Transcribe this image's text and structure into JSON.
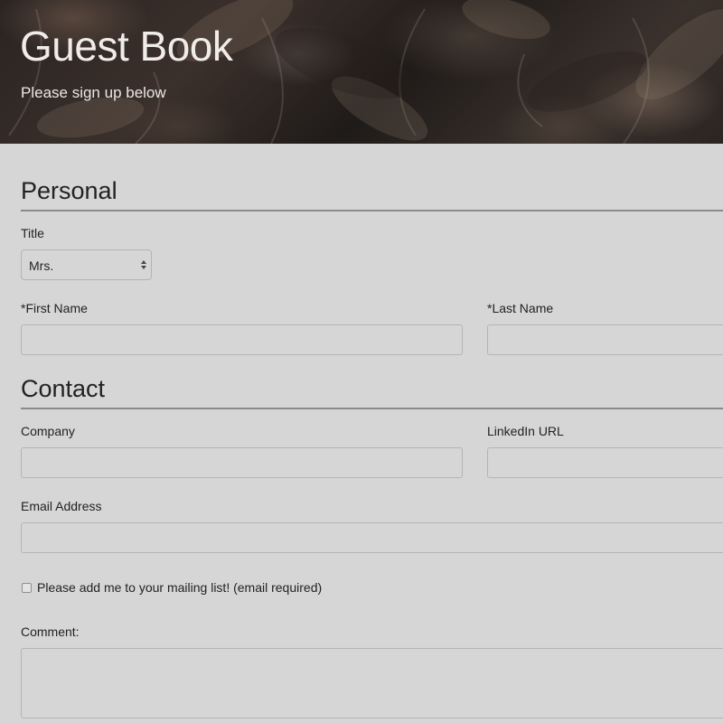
{
  "header": {
    "title": "Guest Book",
    "subtitle": "Please sign up below"
  },
  "personal": {
    "heading": "Personal",
    "title_label": "Title",
    "title_value": "Mrs.",
    "first_name_label": "*First Name",
    "last_name_label": "*Last Name"
  },
  "contact": {
    "heading": "Contact",
    "company_label": "Company",
    "linkedin_label": "LinkedIn URL",
    "email_label": "Email Address",
    "mailing_list_label": "Please add me to your mailing list! (email required)",
    "comment_label": "Comment:"
  },
  "colors": {
    "background": "#d6d6d6",
    "rule": "#8a8a8a",
    "field_border": "#b4b4b4"
  }
}
